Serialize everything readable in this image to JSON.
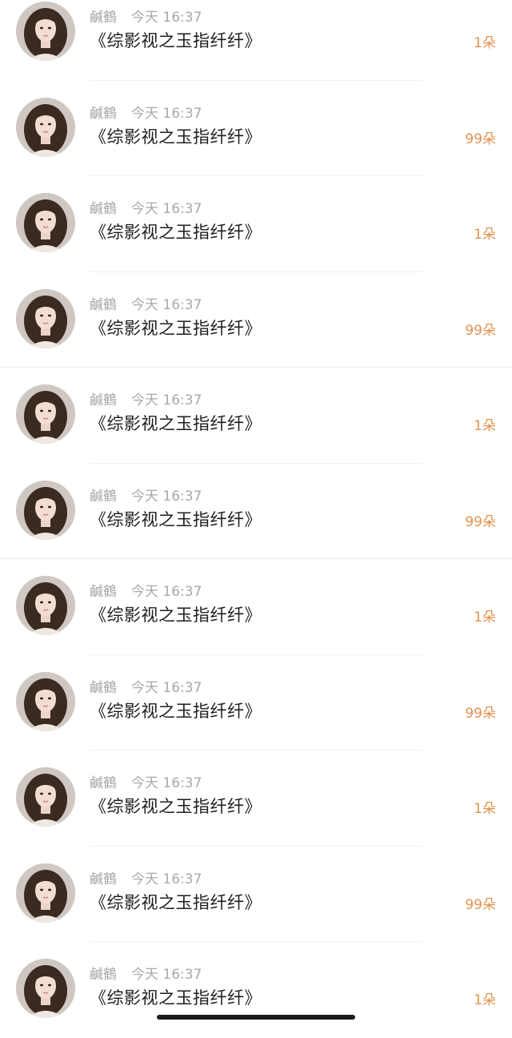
{
  "messages": [
    {
      "name": "鹹鶴",
      "time": "今天 16:37",
      "title": "《综影视之玉指纤纤》",
      "count": "1朵"
    },
    {
      "name": "鹹鶴",
      "time": "今天 16:37",
      "title": "《综影视之玉指纤纤》",
      "count": "99朵"
    },
    {
      "name": "鹹鶴",
      "time": "今天 16:37",
      "title": "《综影视之玉指纤纤》",
      "count": "1朵"
    },
    {
      "name": "鹹鶴",
      "time": "今天 16:37",
      "title": "《综影视之玉指纤纤》",
      "count": "99朵"
    },
    {
      "name": "鹹鶴",
      "time": "今天 16:37",
      "title": "《综影视之玉指纤纤》",
      "count": "1朵"
    },
    {
      "name": "鹹鶴",
      "time": "今天 16:37",
      "title": "《综影视之玉指纤纤》",
      "count": "99朵"
    },
    {
      "name": "鹹鶴",
      "time": "今天 16:37",
      "title": "《综影视之玉指纤纤》",
      "count": "1朵"
    },
    {
      "name": "鹹鶴",
      "time": "今天 16:37",
      "title": "《综影视之玉指纤纤》",
      "count": "99朵"
    },
    {
      "name": "鹹鶴",
      "time": "今天 16:37",
      "title": "《综影视之玉指纤纤》",
      "count": "1朵"
    },
    {
      "name": "鹹鶴",
      "time": "今天 16:37",
      "title": "《综影视之玉指纤纤》",
      "count": "99朵"
    },
    {
      "name": "鹹鶴",
      "time": "今天 16:37",
      "title": "《综影视之玉指纤纤》",
      "count": "1朵"
    }
  ],
  "colors": {
    "count_accent": "#e3924e",
    "meta_text": "#a9a9a9",
    "title_text": "#1e1e1e"
  },
  "icons": {
    "avatar": "avatar-photo"
  }
}
